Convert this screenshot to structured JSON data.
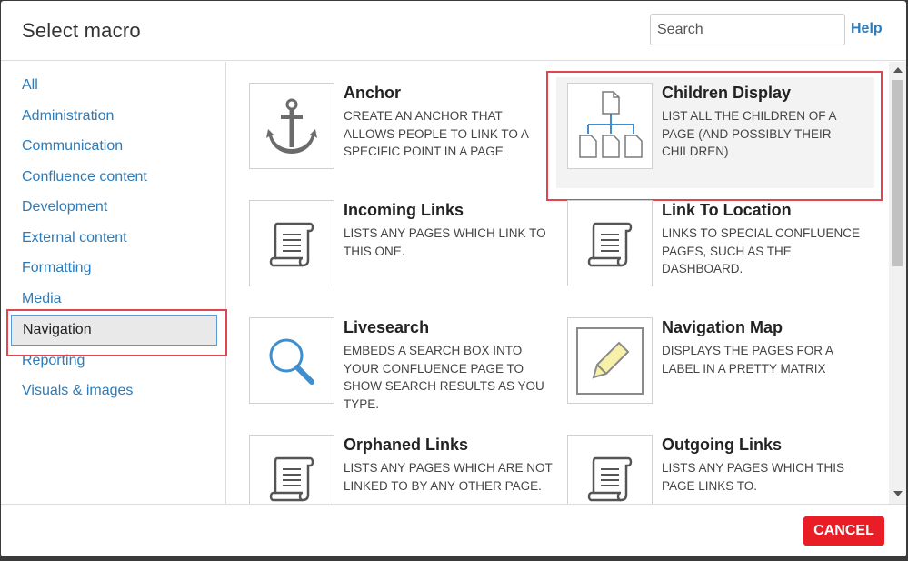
{
  "dialog": {
    "title": "Select macro",
    "search_placeholder": "Search",
    "help_label": "Help",
    "cancel_label": "CANCEL"
  },
  "sidebar": {
    "items": [
      {
        "label": "All"
      },
      {
        "label": "Administration"
      },
      {
        "label": "Communication"
      },
      {
        "label": "Confluence content"
      },
      {
        "label": "Development"
      },
      {
        "label": "External content"
      },
      {
        "label": "Formatting"
      },
      {
        "label": "Media"
      },
      {
        "label": "Navigation",
        "selected": true
      },
      {
        "label": "Reporting"
      },
      {
        "label": "Visuals & images"
      }
    ]
  },
  "macros": [
    {
      "title": "Anchor",
      "description": "Create an anchor that allows people to link to a specific point in a page",
      "icon": "anchor-icon"
    },
    {
      "title": "Children Display",
      "description": "List all the children of a page (and possibly their children)",
      "icon": "page-tree-icon",
      "highlighted": true
    },
    {
      "title": "Incoming Links",
      "description": "Lists any pages which link to this one.",
      "icon": "scroll-icon"
    },
    {
      "title": "Link To Location",
      "description": "Links to special Confluence pages, such as the dashboard.",
      "icon": "scroll-icon"
    },
    {
      "title": "Livesearch",
      "description": "Embeds a search box into your Confluence page to show search results as you type.",
      "icon": "magnifier-icon"
    },
    {
      "title": "Navigation Map",
      "description": "Displays the pages for a label in a pretty matrix",
      "icon": "pencil-icon"
    },
    {
      "title": "Orphaned Links",
      "description": "Lists any pages which are not linked to by any other page.",
      "icon": "scroll-icon"
    },
    {
      "title": "Outgoing Links",
      "description": "Lists any pages which this page links to.",
      "icon": "scroll-icon"
    }
  ],
  "colors": {
    "link": "#2d7bb8",
    "cancel": "#e81d26",
    "annotation": "#e0464f"
  }
}
